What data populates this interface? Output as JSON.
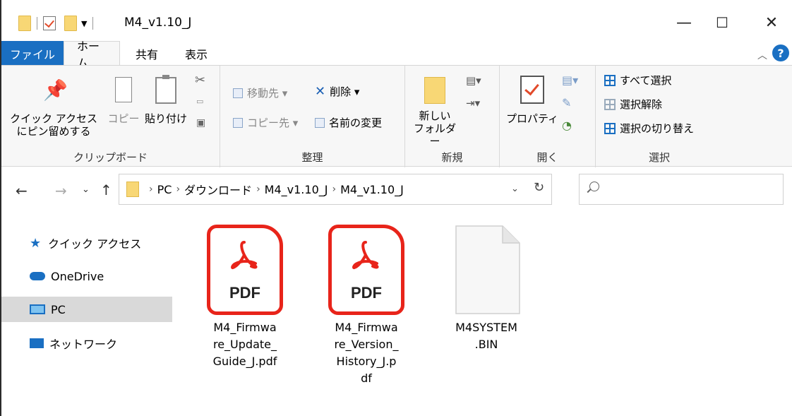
{
  "window": {
    "title": "M4_v1.10_J",
    "controls": {
      "minimize": "—",
      "maximize": "☐",
      "close": "✕"
    }
  },
  "tabs": [
    {
      "label": "ファイル"
    },
    {
      "label": "ホーム"
    },
    {
      "label": "共有"
    },
    {
      "label": "表示"
    }
  ],
  "help": "?",
  "ribbon": {
    "clipboard": {
      "group_label": "クリップボード",
      "pin_line1": "クイック アクセス",
      "pin_line2": "にピン留めする",
      "copy": "コピー",
      "paste": "貼り付け"
    },
    "organize": {
      "group_label": "整理",
      "move_to": "移動先 ▾",
      "copy_to": "コピー先 ▾",
      "delete": "削除 ▾",
      "rename": "名前の変更"
    },
    "new": {
      "group_label": "新規",
      "new_folder_line1": "新しい",
      "new_folder_line2": "フォルダー"
    },
    "open": {
      "group_label": "開く",
      "properties": "プロパティ"
    },
    "select": {
      "group_label": "選択",
      "select_all": "すべて選択",
      "select_none": "選択解除",
      "invert": "選択の切り替え"
    }
  },
  "address": {
    "crumbs": [
      "PC",
      "ダウンロード",
      "M4_v1.10_J",
      "M4_v1.10_J"
    ],
    "search_placeholder": ""
  },
  "nav": [
    {
      "label": "クイック アクセス",
      "icon": "star-icon"
    },
    {
      "label": "OneDrive",
      "icon": "cloud-icon"
    },
    {
      "label": "PC",
      "icon": "pc-icon",
      "selected": true
    },
    {
      "label": "ネットワーク",
      "icon": "network-icon"
    }
  ],
  "files": [
    {
      "name": "M4_Firmware_Update_Guide_J.pdf",
      "lines": [
        "M4_Firmwa",
        "re_Update_",
        "Guide_J.pdf"
      ],
      "type_label": "PDF"
    },
    {
      "name": "M4_Firmware_Version_History_J.pdf",
      "lines": [
        "M4_Firmwa",
        "re_Version_",
        "History_J.p",
        "df"
      ],
      "type_label": "PDF"
    },
    {
      "name": "M4SYSTEM.BIN",
      "lines": [
        "M4SYSTEM",
        ".BIN"
      ]
    }
  ],
  "colors": {
    "accent": "#1a6fc2",
    "pdf_red": "#e8241a",
    "folder": "#f8d775"
  }
}
